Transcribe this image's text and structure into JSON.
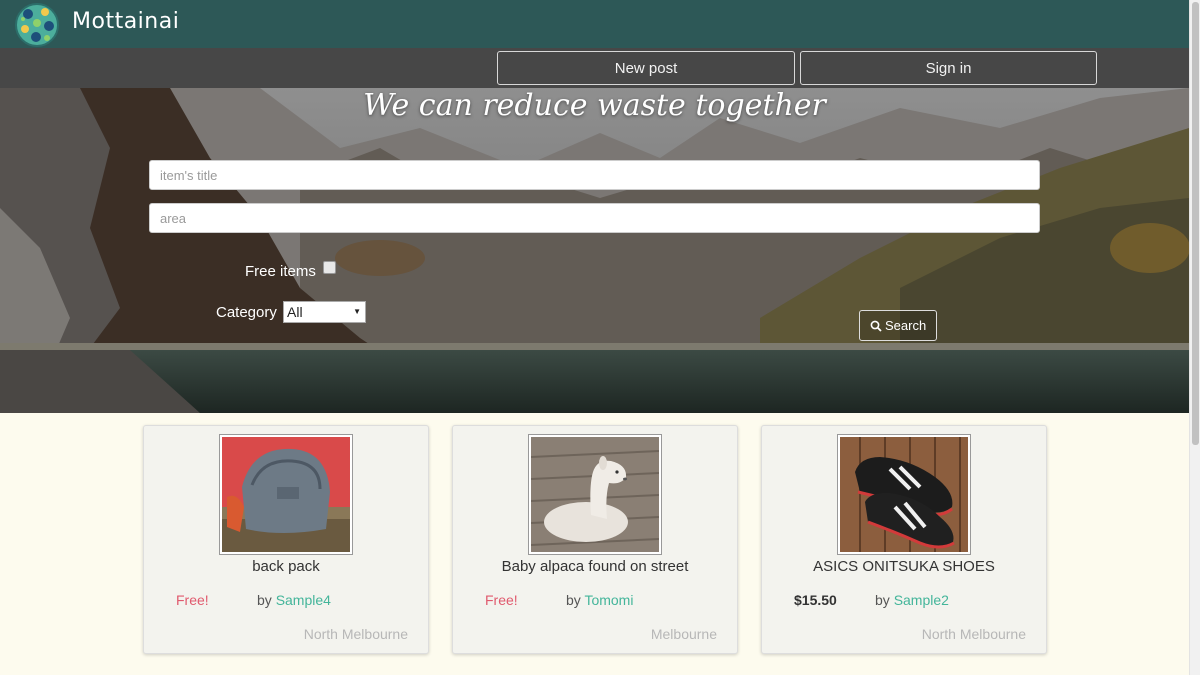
{
  "brand": {
    "name": "Mottainai"
  },
  "nav": {
    "new_post": "New post",
    "sign_in": "Sign in"
  },
  "hero": {
    "title": "We can reduce waste together",
    "title_placeholder": "item's title",
    "area_placeholder": "area",
    "free_items_label": "Free items",
    "free_items_checked": false,
    "category_label": "Category",
    "category_selected": "All",
    "search_label": "Search"
  },
  "items": [
    {
      "title": "back pack",
      "price": "Free!",
      "by": "by",
      "user": "Sample4",
      "location": "North Melbourne",
      "is_free": true
    },
    {
      "title": "Baby alpaca found on street",
      "price": "Free!",
      "by": "by",
      "user": "Tomomi",
      "location": "Melbourne",
      "is_free": true
    },
    {
      "title": "ASICS ONITSUKA SHOES",
      "price": "$15.50",
      "by": "by",
      "user": "Sample2",
      "location": "North Melbourne",
      "is_free": false
    }
  ],
  "colors": {
    "topbar": "#2d5857",
    "navbar": "#474747",
    "accent": "#43b59a",
    "free": "#e05a6e",
    "page_bg": "#fdfbee"
  }
}
